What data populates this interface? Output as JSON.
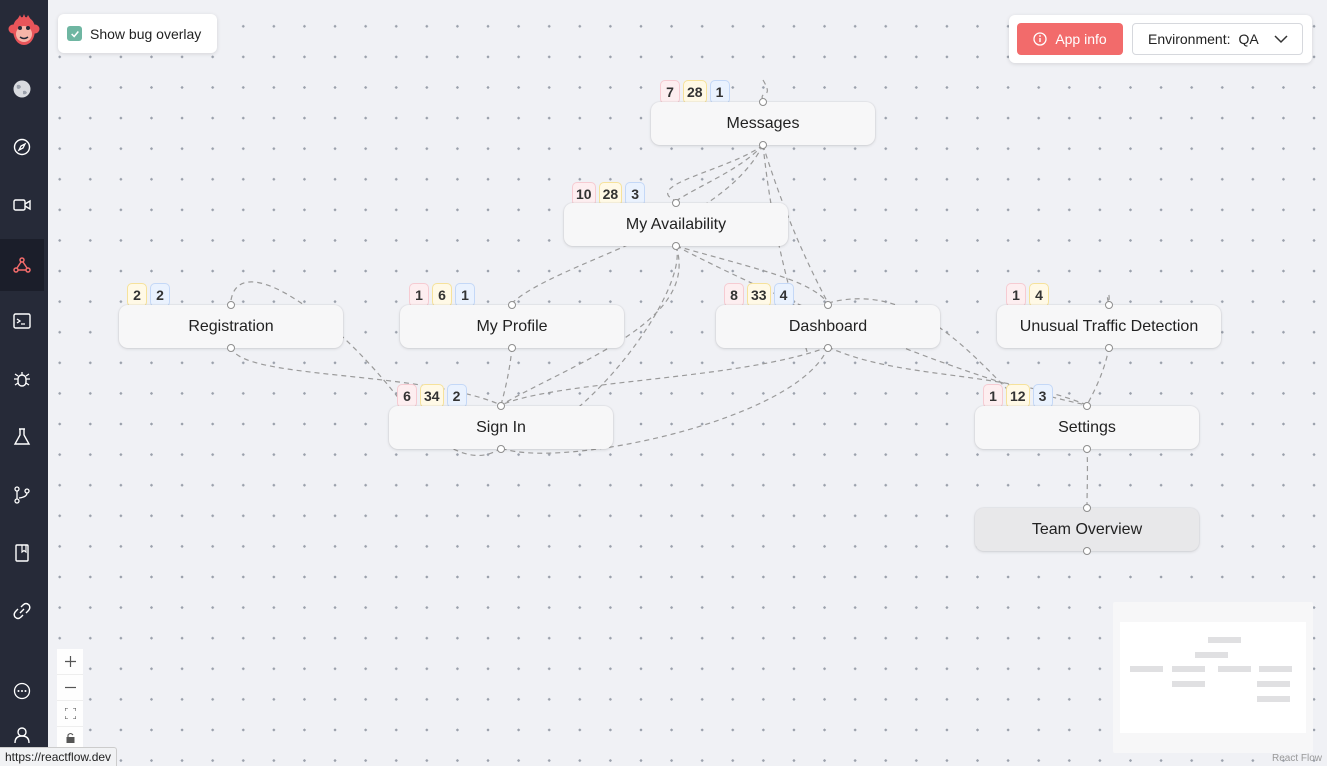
{
  "sidebar": {
    "items": [
      {
        "icon": "globe-icon"
      },
      {
        "icon": "compass-icon"
      },
      {
        "icon": "video-icon"
      },
      {
        "icon": "flow-graph-icon",
        "active": true
      },
      {
        "icon": "terminal-icon"
      },
      {
        "icon": "bug-icon"
      },
      {
        "icon": "flask-icon"
      },
      {
        "icon": "git-branch-icon"
      },
      {
        "icon": "book-icon"
      },
      {
        "icon": "link-icon"
      }
    ],
    "bottom": [
      {
        "icon": "chat-icon"
      },
      {
        "icon": "user-icon"
      }
    ]
  },
  "overlay_toggle": {
    "label": "Show bug overlay",
    "checked": true
  },
  "header": {
    "app_info_label": "App info",
    "environment_label": "Environment:",
    "environment_value": "QA"
  },
  "nodes": {
    "messages": {
      "label": "Messages",
      "badges": [
        "7",
        "28",
        "1"
      ]
    },
    "availability": {
      "label": "My Availability",
      "badges": [
        "10",
        "28",
        "3"
      ]
    },
    "registration": {
      "label": "Registration",
      "badges": [
        "2",
        "2"
      ]
    },
    "profile": {
      "label": "My Profile",
      "badges": [
        "1",
        "6",
        "1"
      ]
    },
    "dashboard": {
      "label": "Dashboard",
      "badges": [
        "8",
        "33",
        "4"
      ]
    },
    "traffic": {
      "label": "Unusual Traffic Detection",
      "badges": [
        "1",
        "4"
      ]
    },
    "signin": {
      "label": "Sign In",
      "badges": [
        "6",
        "34",
        "2"
      ]
    },
    "settings": {
      "label": "Settings",
      "badges": [
        "1",
        "12",
        "3"
      ]
    },
    "team": {
      "label": "Team Overview",
      "badges": []
    }
  },
  "badge_colors": {
    "red": "#fdeef0",
    "yellow": "#fff9e6",
    "blue": "#eaf2fe"
  },
  "accent": "#f26b6b",
  "attribution": "React Flow",
  "status_url": "https://reactflow.dev"
}
